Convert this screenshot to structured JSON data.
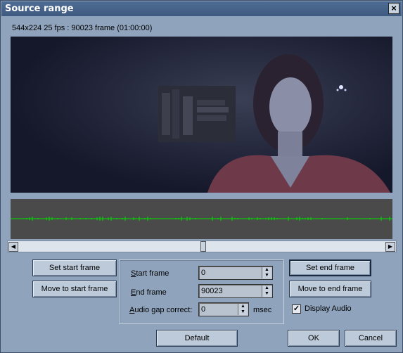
{
  "window": {
    "title": "Source range",
    "close_glyph": "×"
  },
  "info_text": "544x224 25 fps : 90023 frame (01:00:00)",
  "buttons": {
    "set_start": "Set start frame",
    "move_start": "Move to start frame",
    "set_end": "Set end frame",
    "move_end": "Move to end frame",
    "default": "Default",
    "ok": "OK",
    "cancel": "Cancel"
  },
  "fields": {
    "start_frame": {
      "label_first": "S",
      "label_rest": "tart frame",
      "value": "0"
    },
    "end_frame": {
      "label_first": "E",
      "label_rest": "nd frame",
      "value": "90023"
    },
    "audio_gap": {
      "label_first": "A",
      "label_rest": "udio gap correct:",
      "value": "0",
      "unit": "msec"
    }
  },
  "display_audio": {
    "label": "Display Audio",
    "checked": true
  },
  "colors": {
    "waveform": "#00e000",
    "audio_bg": "#4a4a4a"
  }
}
